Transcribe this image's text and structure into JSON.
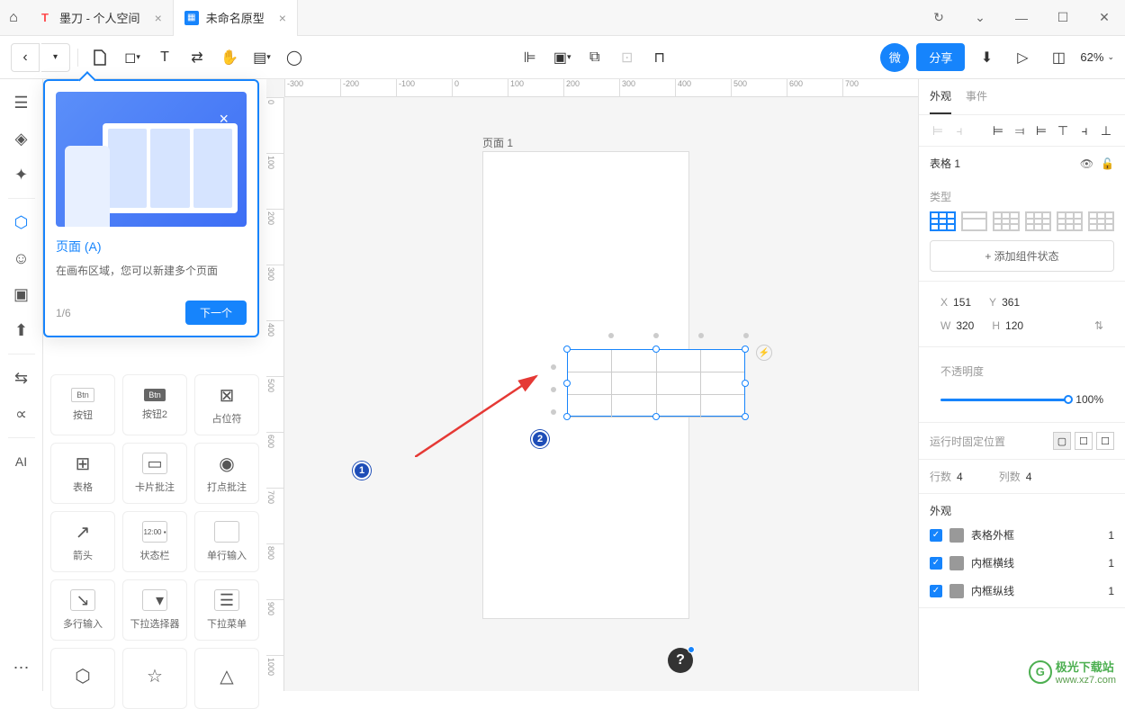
{
  "tabs": [
    {
      "label": "墨刀 - 个人空间",
      "icon": "T",
      "iconColor": "#ff4d4f"
    },
    {
      "label": "未命名原型",
      "icon": "▦",
      "iconColor": "#1684fc"
    }
  ],
  "toolbar": {
    "share": "分享",
    "wei": "微",
    "zoom": "62%"
  },
  "popup": {
    "title": "页面 (A)",
    "desc": "在画布区域，您可以新建多个页面",
    "step": "1/6",
    "next": "下一个"
  },
  "components": [
    {
      "label": "按钮",
      "icon": "Btn",
      "badge": true
    },
    {
      "label": "按钮2",
      "icon": "Btn",
      "badge": true,
      "dark": true
    },
    {
      "label": "占位符",
      "icon": "⊠"
    },
    {
      "label": "表格",
      "icon": "⊞"
    },
    {
      "label": "卡片批注",
      "icon": "▭"
    },
    {
      "label": "打点批注",
      "icon": "◉"
    },
    {
      "label": "箭头",
      "icon": "↗"
    },
    {
      "label": "状态栏",
      "icon": "12:00"
    },
    {
      "label": "单行输入",
      "icon": "▭"
    },
    {
      "label": "多行输入",
      "icon": "▤"
    },
    {
      "label": "下拉选择器",
      "icon": "▾"
    },
    {
      "label": "下拉菜单",
      "icon": "☰"
    },
    {
      "label": "",
      "icon": "⬡"
    },
    {
      "label": "",
      "icon": "☆"
    },
    {
      "label": "",
      "icon": "△"
    }
  ],
  "canvas": {
    "pageLabel": "页面 1",
    "hRuler": [
      "-300",
      "-200",
      "-100",
      "0",
      "100",
      "200",
      "300",
      "400",
      "500",
      "600",
      "700"
    ],
    "vRuler": [
      "0",
      "100",
      "200",
      "300",
      "400",
      "500",
      "600",
      "700",
      "800",
      "900",
      "1000"
    ]
  },
  "rightPanel": {
    "tabs": [
      "外观",
      "事件"
    ],
    "tableName": "表格 1",
    "typeLabel": "类型",
    "addState": "+ 添加组件状态",
    "x": "151",
    "y": "361",
    "w": "320",
    "h": "120",
    "opacityLabel": "不透明度",
    "opacityVal": "100%",
    "fixLabel": "运行时固定位置",
    "rowsLabel": "行数",
    "rowsVal": "4",
    "colsLabel": "列数",
    "colsVal": "4",
    "appearance": "外观",
    "border1": "表格外框",
    "border1Val": "1",
    "border2": "内框横线",
    "border2Val": "1",
    "border3": "内框纵线",
    "border3Val": "1",
    "coordX": "X",
    "coordY": "Y",
    "coordW": "W",
    "coordH": "H"
  },
  "watermark": {
    "text": "极光下载站",
    "url": "www.xz7.com"
  },
  "annotations": {
    "n1": "1",
    "n2": "2"
  }
}
